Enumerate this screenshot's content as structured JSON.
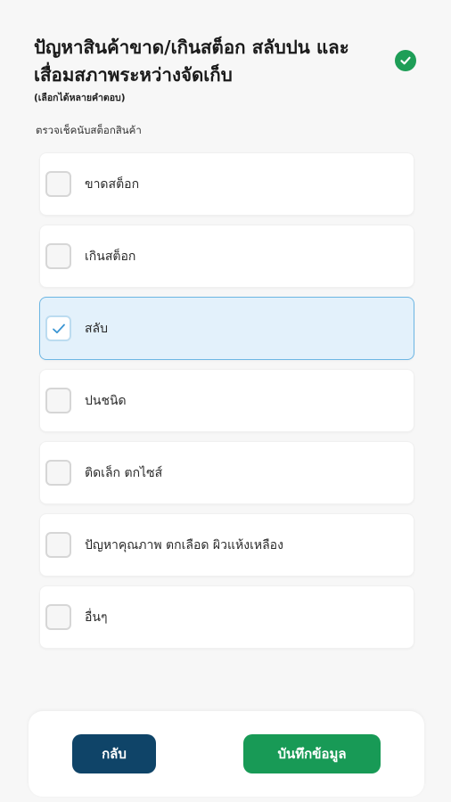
{
  "header": {
    "title": "ปัญหาสินค้าขาด/เกินสต็อก สลับปน และเสื่อมสภาพระหว่างจัดเก็บ",
    "subtitle": "(เลือกได้หลายคำตอบ)"
  },
  "section_label": "ตรวจเช็คนับสต็อกสินค้า",
  "options": [
    {
      "label": "ขาดสต็อก",
      "checked": false
    },
    {
      "label": "เกินสต็อก",
      "checked": false
    },
    {
      "label": "สลับ",
      "checked": true
    },
    {
      "label": "ปนชนิด",
      "checked": false
    },
    {
      "label": "ติดเล็ก ตกไซส์",
      "checked": false
    },
    {
      "label": "ปัญหาคุณภาพ ตกเลือด ผิวแห้งเหลือง",
      "checked": false
    },
    {
      "label": "อื่นๆ",
      "checked": false
    }
  ],
  "footer": {
    "back_label": "กลับ",
    "save_label": "บันทึกข้อมูล"
  },
  "colors": {
    "accent_green": "#1e9e57",
    "back_button": "#0f4468",
    "save_button": "#189a56",
    "selected_bg": "#e3f1fb",
    "check_blue": "#3a95d3"
  },
  "icons": {
    "completed": "check-circle-icon",
    "selected": "checkmark-icon"
  }
}
